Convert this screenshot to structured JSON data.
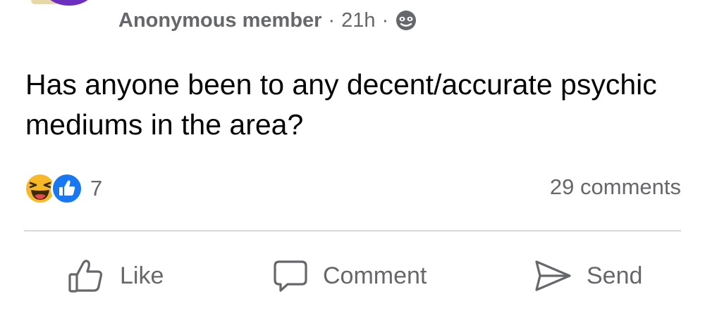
{
  "post": {
    "author": "Anonymous member",
    "separator": "·",
    "time": "21h",
    "audience_icon": "anonymous-mask-icon",
    "text": "Has anyone been to any decent/accurate psychic mediums in the area?"
  },
  "reactions": {
    "icons": [
      "laughing-emoji-icon",
      "thumbs-up-icon"
    ],
    "count": "7"
  },
  "comments_count": "29 comments",
  "actions": {
    "like_label": "Like",
    "comment_label": "Comment",
    "send_label": "Send"
  },
  "colors": {
    "secondary_text": "#65676b",
    "like_blue": "#1877f2",
    "haha_yellow": "#f7b928",
    "divider": "#d6d8db"
  }
}
